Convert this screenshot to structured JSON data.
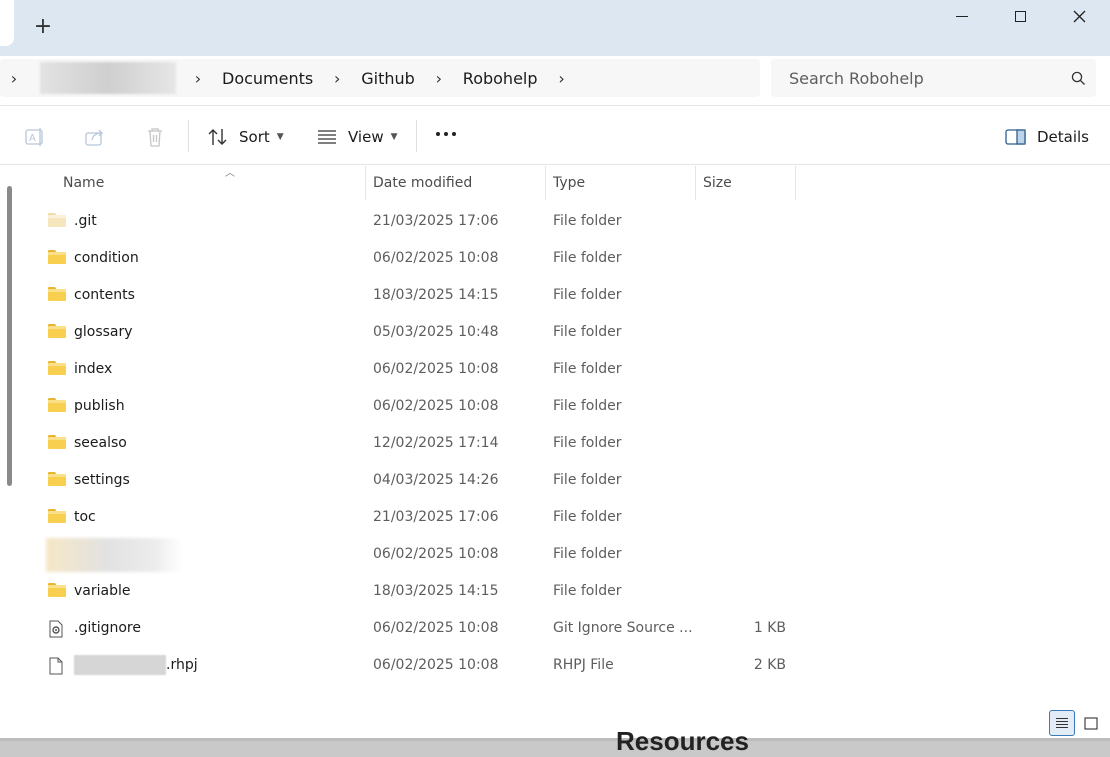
{
  "window": {
    "new_tab_label": "+",
    "controls": {
      "minimize": "minimize",
      "maximize": "maximize",
      "close": "✕"
    }
  },
  "address": {
    "breadcrumbs": [
      "Documents",
      "Github",
      "Robohelp"
    ]
  },
  "search": {
    "placeholder": "Search Robohelp"
  },
  "toolbar": {
    "sort_label": "Sort",
    "view_label": "View",
    "details_label": "Details"
  },
  "columns": {
    "name": "Name",
    "date": "Date modified",
    "type": "Type",
    "size": "Size"
  },
  "files": [
    {
      "name": ".git",
      "date": "21/03/2025 17:06",
      "type": "File folder",
      "size": "",
      "icon": "folder-faded-icon"
    },
    {
      "name": "condition",
      "date": "06/02/2025 10:08",
      "type": "File folder",
      "size": "",
      "icon": "folder-icon"
    },
    {
      "name": "contents",
      "date": "18/03/2025 14:15",
      "type": "File folder",
      "size": "",
      "icon": "folder-icon"
    },
    {
      "name": "glossary",
      "date": "05/03/2025 10:48",
      "type": "File folder",
      "size": "",
      "icon": "folder-icon"
    },
    {
      "name": "index",
      "date": "06/02/2025 10:08",
      "type": "File folder",
      "size": "",
      "icon": "folder-icon"
    },
    {
      "name": "publish",
      "date": "06/02/2025 10:08",
      "type": "File folder",
      "size": "",
      "icon": "folder-icon"
    },
    {
      "name": "seealso",
      "date": "12/02/2025 17:14",
      "type": "File folder",
      "size": "",
      "icon": "folder-icon"
    },
    {
      "name": "settings",
      "date": "04/03/2025 14:26",
      "type": "File folder",
      "size": "",
      "icon": "folder-icon"
    },
    {
      "name": "toc",
      "date": "21/03/2025 17:06",
      "type": "File folder",
      "size": "",
      "icon": "folder-icon"
    },
    {
      "name": "",
      "date": "06/02/2025 10:08",
      "type": "File folder",
      "size": "",
      "icon": "folder-icon"
    },
    {
      "name": "variable",
      "date": "18/03/2025 14:15",
      "type": "File folder",
      "size": "",
      "icon": "folder-icon"
    },
    {
      "name": ".gitignore",
      "date": "06/02/2025 10:08",
      "type": "Git Ignore Source ...",
      "size": "1 KB",
      "icon": "settings-file-icon"
    },
    {
      "name": ".rhpj",
      "date": "06/02/2025 10:08",
      "type": "RHPJ File",
      "size": "2 KB",
      "icon": "file-icon"
    }
  ],
  "background_peek_text": "Resources"
}
